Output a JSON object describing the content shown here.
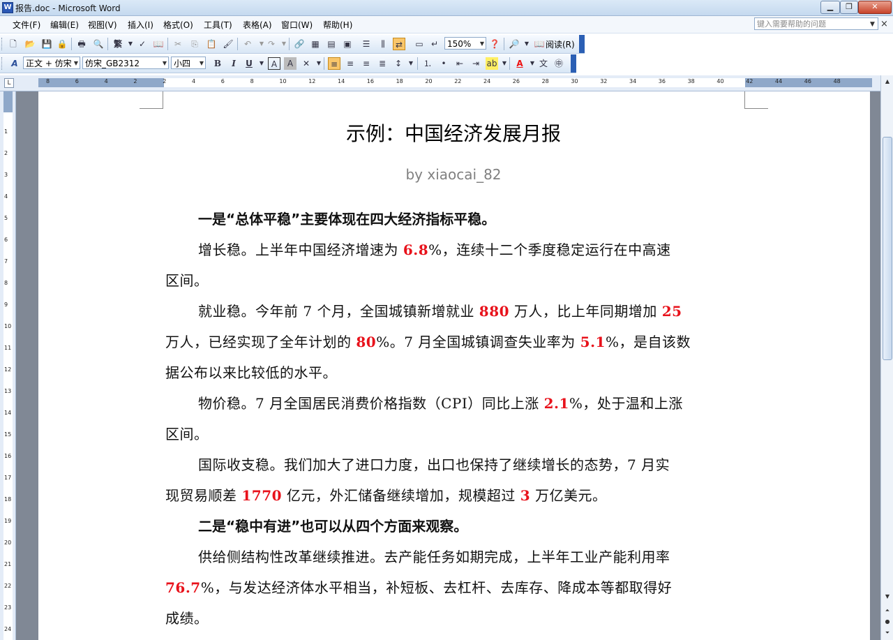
{
  "window": {
    "title": "报告.doc - Microsoft Word",
    "controls": {
      "minimize": "▁",
      "restore": "❐",
      "close": "✕"
    }
  },
  "menu": {
    "items": [
      "文件(F)",
      "编辑(E)",
      "视图(V)",
      "插入(I)",
      "格式(O)",
      "工具(T)",
      "表格(A)",
      "窗口(W)",
      "帮助(H)"
    ],
    "help_placeholder": "键入需要帮助的问题"
  },
  "standard_toolbar": {
    "zoom": "150%",
    "reading_label": "阅读(R)",
    "traditional_label": "繁"
  },
  "format_toolbar": {
    "style": "正文 + 仿宋",
    "font": "仿宋_GB2312",
    "size": "小四",
    "bold": "B",
    "italic": "I",
    "underline": "U"
  },
  "ruler": {
    "numbers": [
      "8",
      "6",
      "4",
      "2",
      "2",
      "4",
      "6",
      "8",
      "10",
      "12",
      "14",
      "16",
      "18",
      "20",
      "22",
      "24",
      "26",
      "28",
      "30",
      "32",
      "34",
      "36",
      "38",
      "40",
      "42",
      "44",
      "46",
      "48"
    ],
    "vnumbers": [
      "1",
      "2",
      "3",
      "4",
      "5",
      "6",
      "7",
      "8",
      "9",
      "10",
      "11",
      "12",
      "13",
      "14",
      "15",
      "16",
      "17",
      "18",
      "19",
      "20",
      "21",
      "22",
      "23",
      "24"
    ]
  },
  "document": {
    "title": "示例：中国经济发展月报",
    "byline": "by     xiaocai_82",
    "lines": [
      {
        "style": "bold",
        "indent": true,
        "parts": [
          {
            "t": "一是“总体平稳”主要体现在四大经济指标平稳。"
          }
        ]
      },
      {
        "indent": true,
        "parts": [
          {
            "t": "增长稳。上半年中国经济增速为 "
          },
          {
            "t": "6.8",
            "red": true
          },
          {
            "t": "%，连续十二个季度稳定运行在中高速"
          }
        ]
      },
      {
        "parts": [
          {
            "t": "区间。"
          }
        ]
      },
      {
        "indent": true,
        "parts": [
          {
            "t": "就业稳。今年前 7 个月，全国城镇新增就业 "
          },
          {
            "t": "880",
            "red": true
          },
          {
            "t": " 万人，比上年同期增加 "
          },
          {
            "t": "25",
            "red": true
          }
        ]
      },
      {
        "parts": [
          {
            "t": "万人，已经实现了全年计划的 "
          },
          {
            "t": "80",
            "red": true
          },
          {
            "t": "%。7 月全国城镇调查失业率为 "
          },
          {
            "t": "5.1",
            "red": true
          },
          {
            "t": "%，是自该数"
          }
        ]
      },
      {
        "parts": [
          {
            "t": "据公布以来比较低的水平。"
          }
        ]
      },
      {
        "indent": true,
        "parts": [
          {
            "t": "物价稳。7 月全国居民消费价格指数（CPI）同比上涨 "
          },
          {
            "t": "2.1",
            "red": true
          },
          {
            "t": "%，处于温和上涨"
          }
        ]
      },
      {
        "parts": [
          {
            "t": "区间。"
          }
        ]
      },
      {
        "indent": true,
        "parts": [
          {
            "t": "国际收支稳。我们加大了进口力度，出口也保持了继续增长的态势，7 月实"
          }
        ]
      },
      {
        "parts": [
          {
            "t": "现贸易顺差 "
          },
          {
            "t": "1770",
            "red": true
          },
          {
            "t": " 亿元，外汇储备继续增加，规模超过 "
          },
          {
            "t": "3",
            "red": true
          },
          {
            "t": " 万亿美元。"
          }
        ]
      },
      {
        "style": "bold",
        "indent": true,
        "parts": [
          {
            "t": "二是“稳中有进”也可以从四个方面来观察。"
          }
        ]
      },
      {
        "indent": true,
        "parts": [
          {
            "t": "供给侧结构性改革继续推进。去产能任务如期完成，上半年工业产能利用率"
          }
        ]
      },
      {
        "parts": [
          {
            "t": "76.7",
            "red": true
          },
          {
            "t": "%，与发达经济体水平相当，补短板、去杠杆、去库存、降成本等都取得好"
          }
        ]
      },
      {
        "parts": [
          {
            "t": "成绩。"
          }
        ]
      }
    ]
  }
}
